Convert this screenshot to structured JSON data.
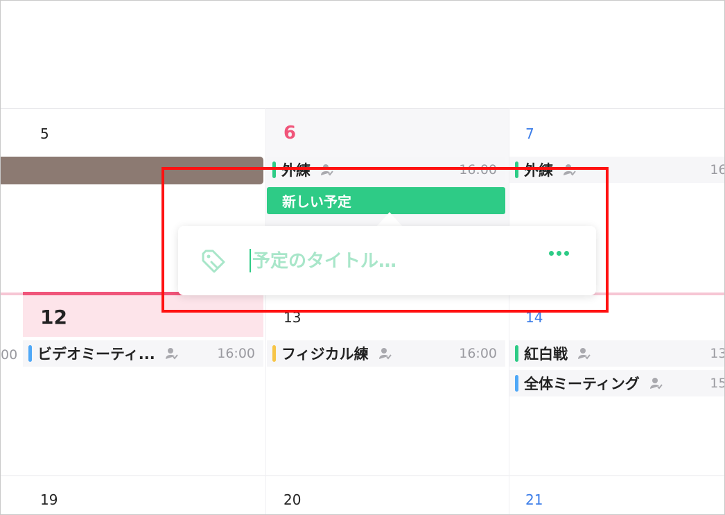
{
  "calendar": {
    "week1": {
      "day5": "5",
      "day6": "6",
      "day7": "7",
      "events": [
        {
          "title": "外練",
          "time": "16:00",
          "color": "#2ecb86"
        },
        {
          "title": "外練",
          "time": "16:",
          "color": "#2ecb86"
        }
      ]
    },
    "week2": {
      "day12": "12",
      "day13": "13",
      "day14": "14",
      "edge_time": "00",
      "events": [
        {
          "title": "ビデオミーティ...",
          "time": "16:00",
          "color": "#4fa8f7"
        },
        {
          "title": "フィジカル練",
          "time": "16:00",
          "color": "#f7c548"
        },
        {
          "title": "紅白戦",
          "time": "13:",
          "color": "#2ecb86"
        },
        {
          "title": "全体ミーティング",
          "time": "15:",
          "color": "#4fa8f7"
        }
      ]
    },
    "week3": {
      "day19": "19",
      "day20": "20",
      "day21": "21"
    }
  },
  "new_event": {
    "label": "新しい予定",
    "title_placeholder": "予定のタイトル…",
    "more_icon": "more-dots-icon",
    "tag_icon": "tag-icon"
  },
  "colors": {
    "today": "#f0557a",
    "saturday": "#3b7de9",
    "accent": "#2ecb86",
    "highlight": "#ff1111"
  }
}
